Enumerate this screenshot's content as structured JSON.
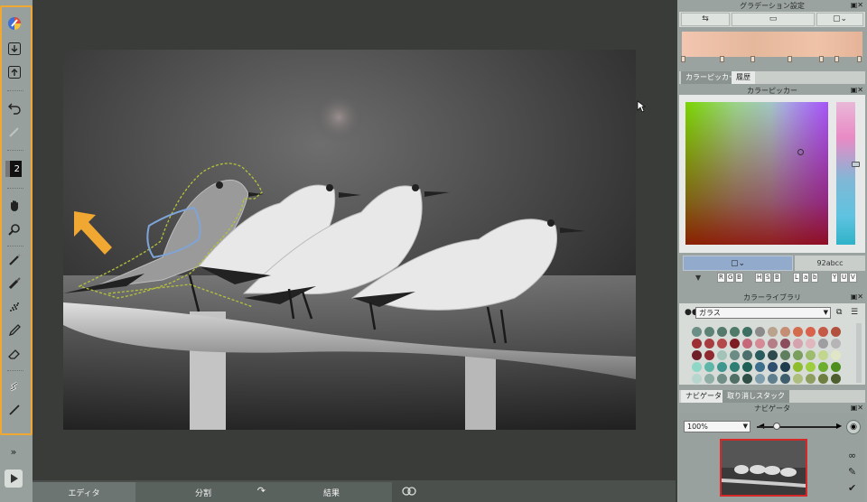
{
  "toolbar": {
    "layer_number": "2",
    "expand_label": "»",
    "tools": [
      "color-brush-icon",
      "import-icon",
      "export-icon",
      "undo-icon",
      "redo-icon",
      "layer-icon",
      "hand-icon",
      "zoom-icon",
      "pen-icon",
      "marker-icon",
      "spray-icon",
      "pencil-icon",
      "eraser-icon",
      "smudge-icon",
      "line-icon"
    ],
    "highlight_color": "#f0a832"
  },
  "bottom_tabs": {
    "editor": "エディタ",
    "split": "分割",
    "result": "結果"
  },
  "gradient_panel": {
    "title": "グラデーション設定"
  },
  "color_panel": {
    "tab_picker": "カラーピッカー",
    "tab_history": "履歴",
    "title": "カラーピッカー",
    "hex_value": "92abcc",
    "current_color": "#92abcc",
    "modes": [
      "R",
      "G",
      "B",
      "H",
      "S",
      "B",
      "L",
      "a",
      "b",
      "Y",
      "U",
      "V"
    ]
  },
  "library_panel": {
    "title": "カラーライブラリ",
    "selected_library": "ガラス"
  },
  "navigator_panel": {
    "tab_navigator": "ナビゲータ",
    "tab_undo": "取り消しスタック",
    "title": "ナビゲータ",
    "zoom": "100%",
    "zoom_level": 0.22
  }
}
